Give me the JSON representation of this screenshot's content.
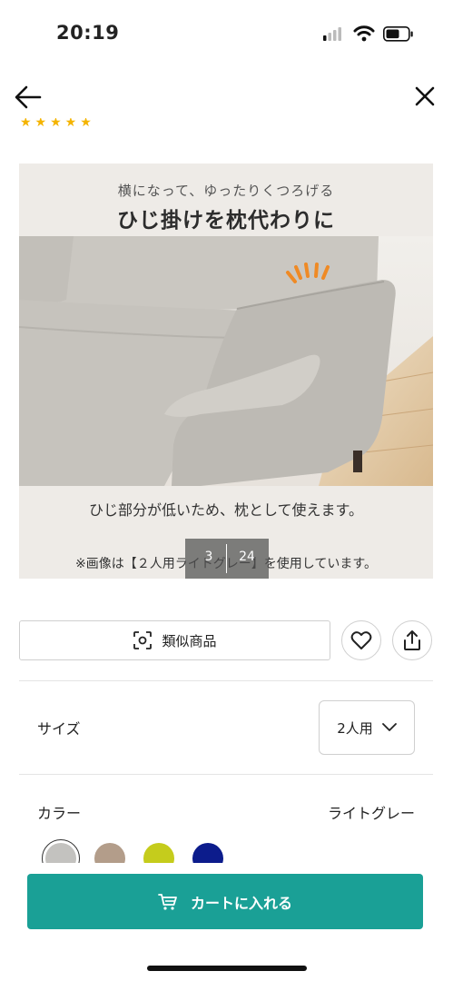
{
  "status_bar": {
    "time": "20:19"
  },
  "product": {
    "image": {
      "subtitle": "横になって、ゆったりくつろげる",
      "title": "ひじ掛けを枕代わりに",
      "description": "ひじ部分が低いため、枕として使えます。",
      "note": "※画像は【２人用ライトグレー】を使用しています。",
      "counter_current": "3",
      "counter_total": "24"
    },
    "actions": {
      "similar_label": "類似商品"
    },
    "size": {
      "label": "サイズ",
      "selected": "2人用"
    },
    "color": {
      "label": "カラー",
      "selected": "ライトグレー",
      "swatches": [
        "#c3c2bf",
        "#b39d8a",
        "#c5cc1c",
        "#0c1c8c"
      ]
    },
    "cart_label": "カートに入れる"
  },
  "colors": {
    "accent": "#1aa096"
  }
}
